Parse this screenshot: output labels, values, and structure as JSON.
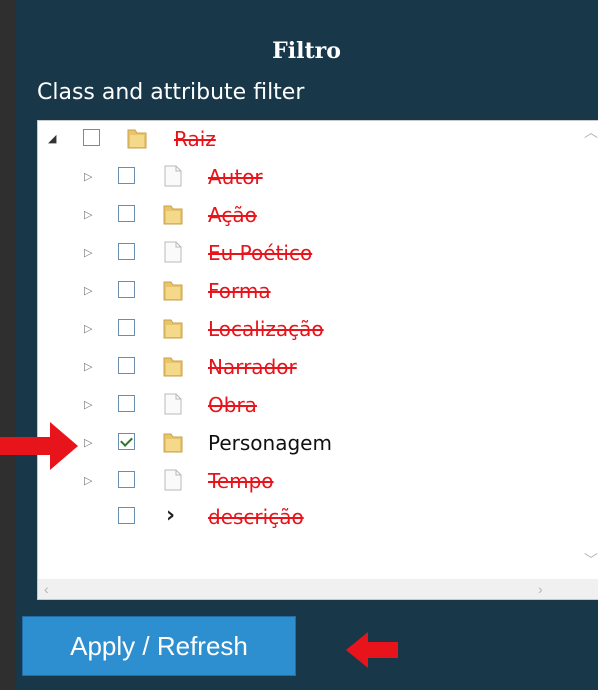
{
  "panel": {
    "title": "Filtro",
    "subtitle": "Class and attribute filter"
  },
  "tree": {
    "root": {
      "label": "Raiz",
      "checked": false,
      "enabled": false,
      "icon": "folder-icon"
    },
    "items": [
      {
        "label": "Autor",
        "checked": false,
        "enabled": false,
        "icon": "file-icon"
      },
      {
        "label": "Ação",
        "checked": false,
        "enabled": false,
        "icon": "folder-icon"
      },
      {
        "label": "Eu Poético",
        "checked": false,
        "enabled": false,
        "icon": "file-icon"
      },
      {
        "label": "Forma",
        "checked": false,
        "enabled": false,
        "icon": "folder-icon"
      },
      {
        "label": "Localização",
        "checked": false,
        "enabled": false,
        "icon": "folder-icon"
      },
      {
        "label": "Narrador",
        "checked": false,
        "enabled": false,
        "icon": "folder-icon"
      },
      {
        "label": "Obra",
        "checked": false,
        "enabled": false,
        "icon": "file-icon"
      },
      {
        "label": "Personagem",
        "checked": true,
        "enabled": true,
        "icon": "folder-icon"
      },
      {
        "label": "Tempo",
        "checked": false,
        "enabled": false,
        "icon": "file-icon"
      }
    ],
    "attribute": {
      "label": "descrição",
      "checked": false,
      "enabled": false,
      "icon": "chevron-right-icon"
    }
  },
  "apply_button": {
    "label": "Apply / Refresh"
  },
  "colors": {
    "panel_bg": "#18384a",
    "disabled_text": "#e8141b",
    "button_bg": "#2e8fd0",
    "annotation_arrow": "#e8141b"
  }
}
